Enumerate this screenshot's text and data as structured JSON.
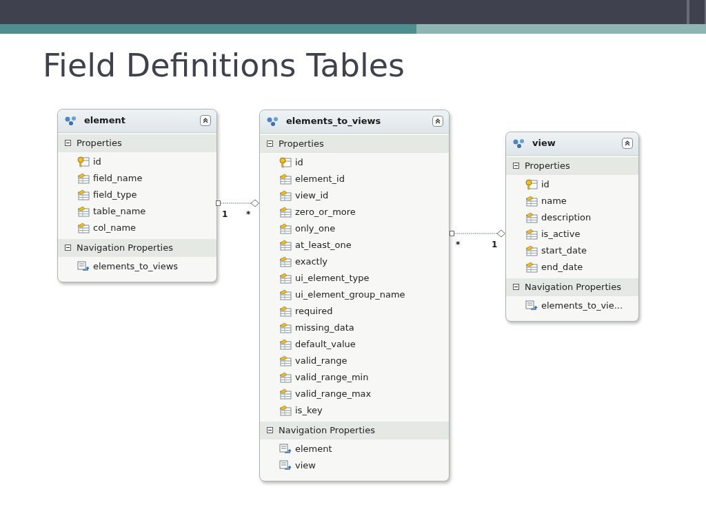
{
  "slide": {
    "title": "Field Definitions Tables"
  },
  "entities": [
    {
      "name": "element",
      "sections": [
        {
          "label": "Properties",
          "expanded": true,
          "items": [
            {
              "name": "id",
              "kind": "key"
            },
            {
              "name": "field_name",
              "kind": "property"
            },
            {
              "name": "field_type",
              "kind": "property"
            },
            {
              "name": "table_name",
              "kind": "property"
            },
            {
              "name": "col_name",
              "kind": "property"
            }
          ]
        },
        {
          "label": "Navigation Properties",
          "expanded": true,
          "items": [
            {
              "name": "elements_to_views",
              "kind": "navigation"
            }
          ]
        }
      ]
    },
    {
      "name": "elements_to_views",
      "sections": [
        {
          "label": "Properties",
          "expanded": true,
          "items": [
            {
              "name": "id",
              "kind": "key"
            },
            {
              "name": "element_id",
              "kind": "property"
            },
            {
              "name": "view_id",
              "kind": "property"
            },
            {
              "name": "zero_or_more",
              "kind": "property"
            },
            {
              "name": "only_one",
              "kind": "property"
            },
            {
              "name": "at_least_one",
              "kind": "property"
            },
            {
              "name": "exactly",
              "kind": "property"
            },
            {
              "name": "ui_element_type",
              "kind": "property"
            },
            {
              "name": "ui_element_group_name",
              "kind": "property"
            },
            {
              "name": "required",
              "kind": "property"
            },
            {
              "name": "missing_data",
              "kind": "property"
            },
            {
              "name": "default_value",
              "kind": "property"
            },
            {
              "name": "valid_range",
              "kind": "property"
            },
            {
              "name": "valid_range_min",
              "kind": "property"
            },
            {
              "name": "valid_range_max",
              "kind": "property"
            },
            {
              "name": "is_key",
              "kind": "property"
            }
          ]
        },
        {
          "label": "Navigation Properties",
          "expanded": true,
          "items": [
            {
              "name": "element",
              "kind": "navigation"
            },
            {
              "name": "view",
              "kind": "navigation"
            }
          ]
        }
      ]
    },
    {
      "name": "view",
      "sections": [
        {
          "label": "Properties",
          "expanded": true,
          "items": [
            {
              "name": "id",
              "kind": "key"
            },
            {
              "name": "name",
              "kind": "property"
            },
            {
              "name": "description",
              "kind": "property"
            },
            {
              "name": "is_active",
              "kind": "property"
            },
            {
              "name": "start_date",
              "kind": "property"
            },
            {
              "name": "end_date",
              "kind": "property"
            }
          ]
        },
        {
          "label": "Navigation Properties",
          "expanded": true,
          "items": [
            {
              "name": "elements_to_vie...",
              "kind": "navigation"
            }
          ]
        }
      ]
    }
  ],
  "associations": [
    {
      "from_end": "1",
      "to_end": "*"
    },
    {
      "from_end": "*",
      "to_end": "1"
    }
  ]
}
